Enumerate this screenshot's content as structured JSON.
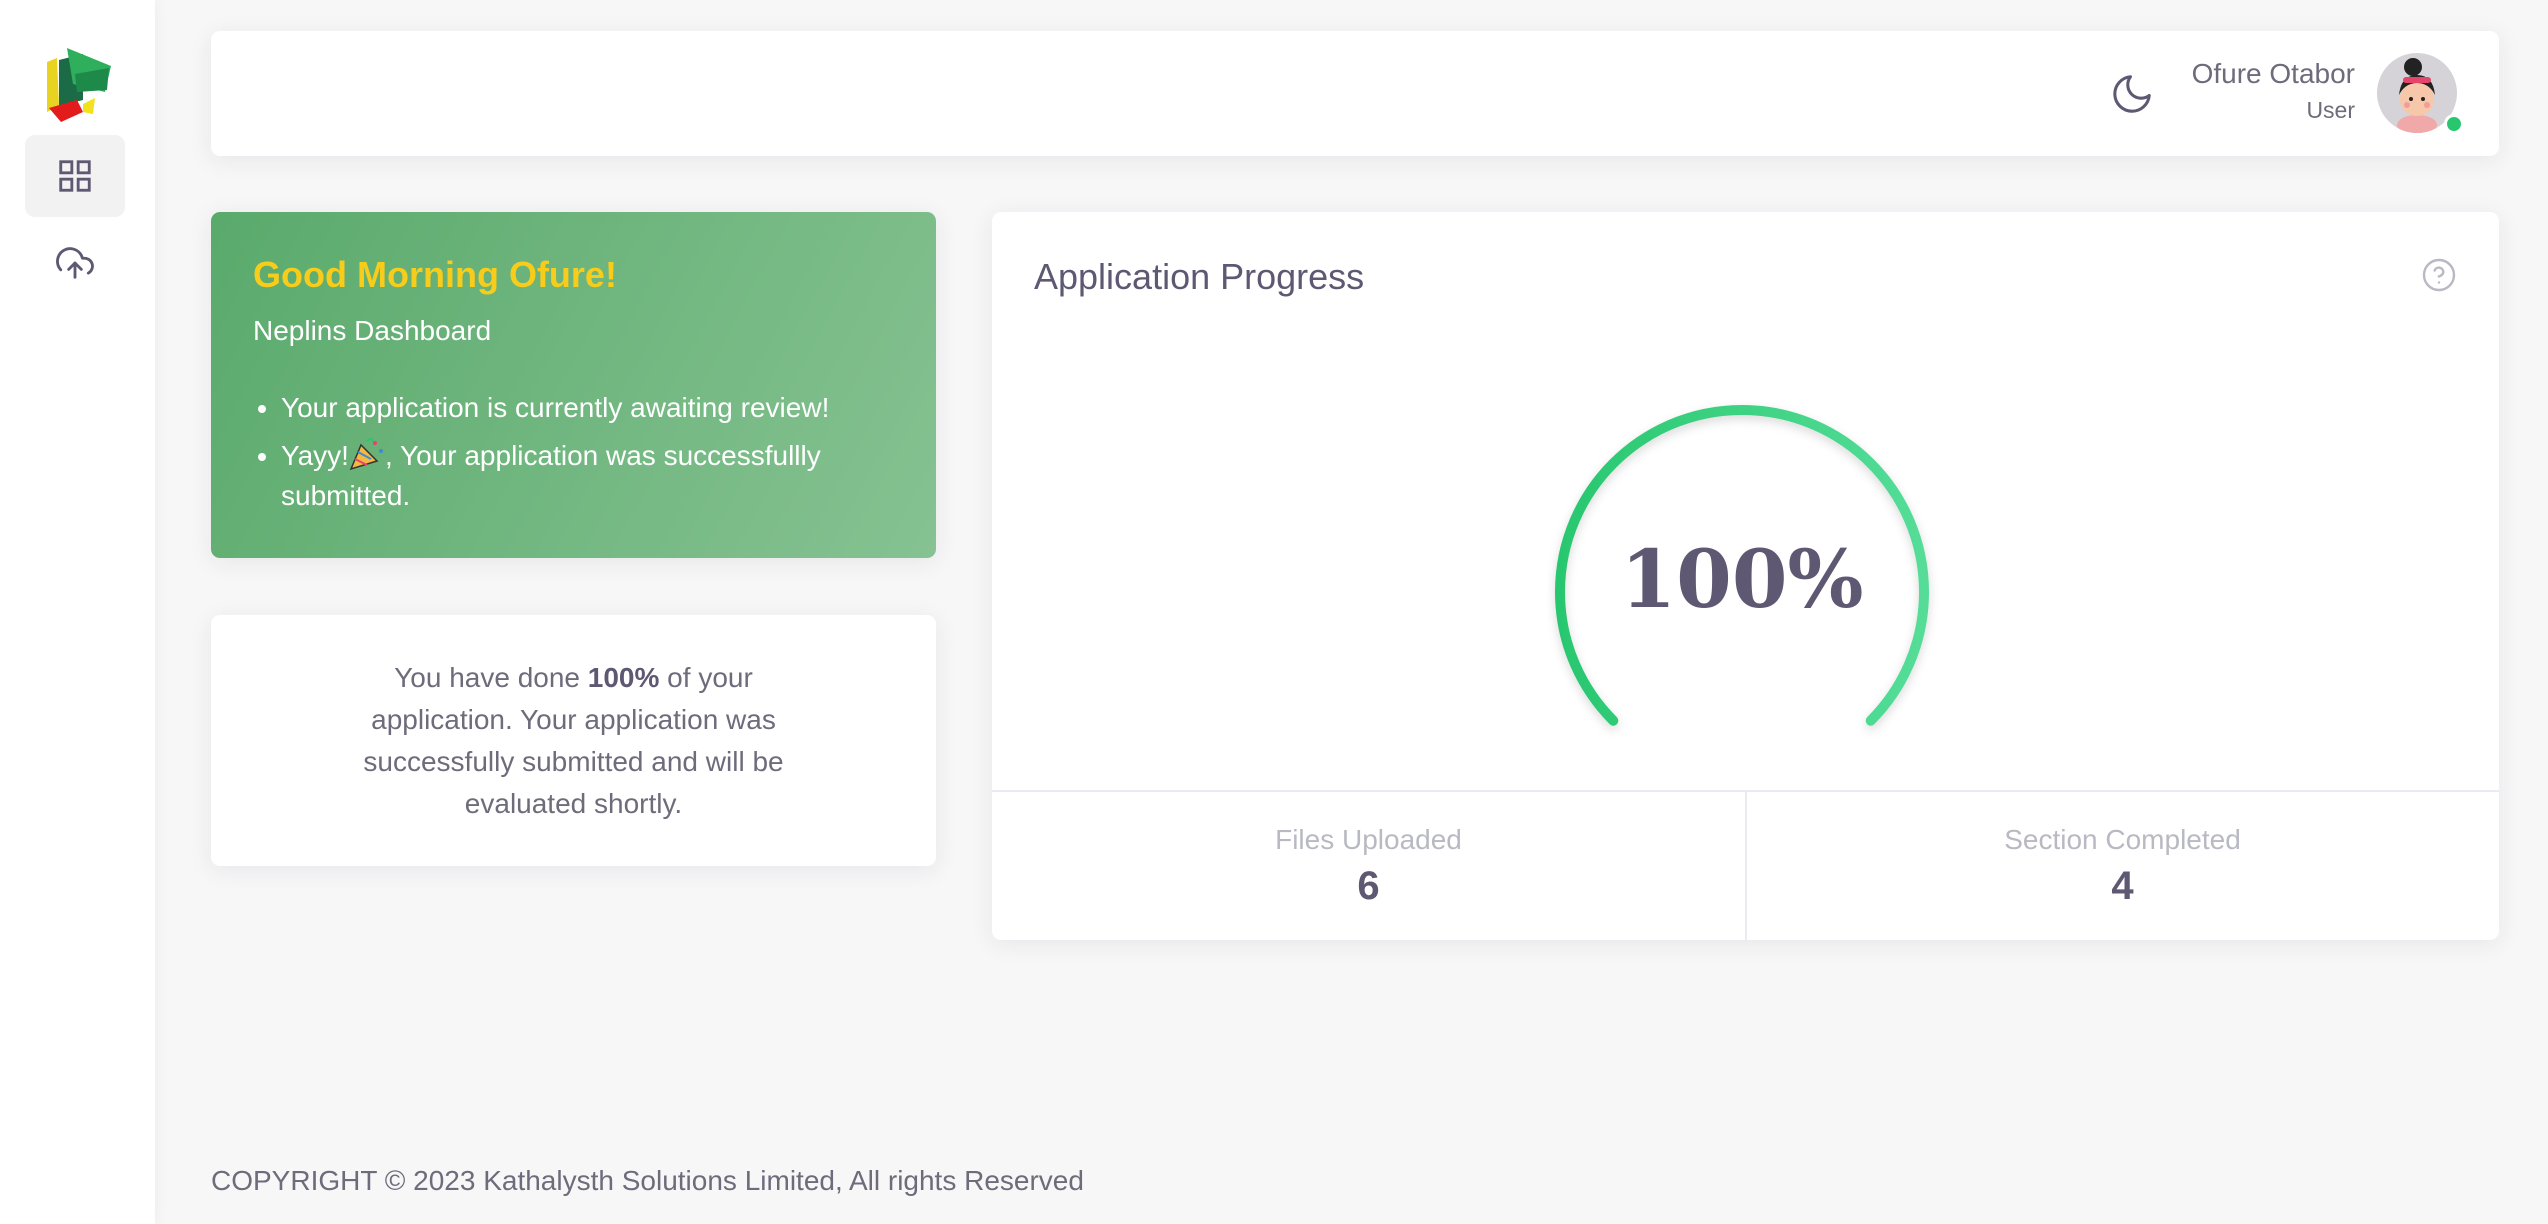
{
  "sidebar": {
    "items": [
      {
        "name": "dashboard",
        "icon": "grid-icon",
        "active": true
      },
      {
        "name": "upload",
        "icon": "cloud-upload-icon",
        "active": false
      }
    ]
  },
  "header": {
    "theme_icon": "moon-icon",
    "user_name": "Ofure Otabor",
    "user_role": "User",
    "status_color": "#28c76f"
  },
  "greeting": {
    "title": "Good Morning Ofure!",
    "subtitle": "Neplins Dashboard",
    "items": [
      "Your application is currently awaiting review!",
      {
        "prefix": "Yayy!",
        "suffix": ", Your application was successfullly submitted."
      }
    ],
    "title_color": "#f7cc1a"
  },
  "summary": {
    "before": "You have done ",
    "percent": "100%",
    "after": " of your application. Your application was successfully submitted and will be evaluated shortly."
  },
  "progress": {
    "title": "Application Progress",
    "value_label": "100%",
    "value": 1.0,
    "stats": [
      {
        "label": "Files Uploaded",
        "value": "6"
      },
      {
        "label": "Section Completed",
        "value": "4"
      }
    ]
  },
  "footer": {
    "text": "COPYRIGHT © 2023 Kathalysth Solutions Limited, All rights Reserved"
  },
  "colors": {
    "accent_green": "#28c76f",
    "gauge_start": "#28c76f",
    "gauge_end": "#55dd98"
  }
}
